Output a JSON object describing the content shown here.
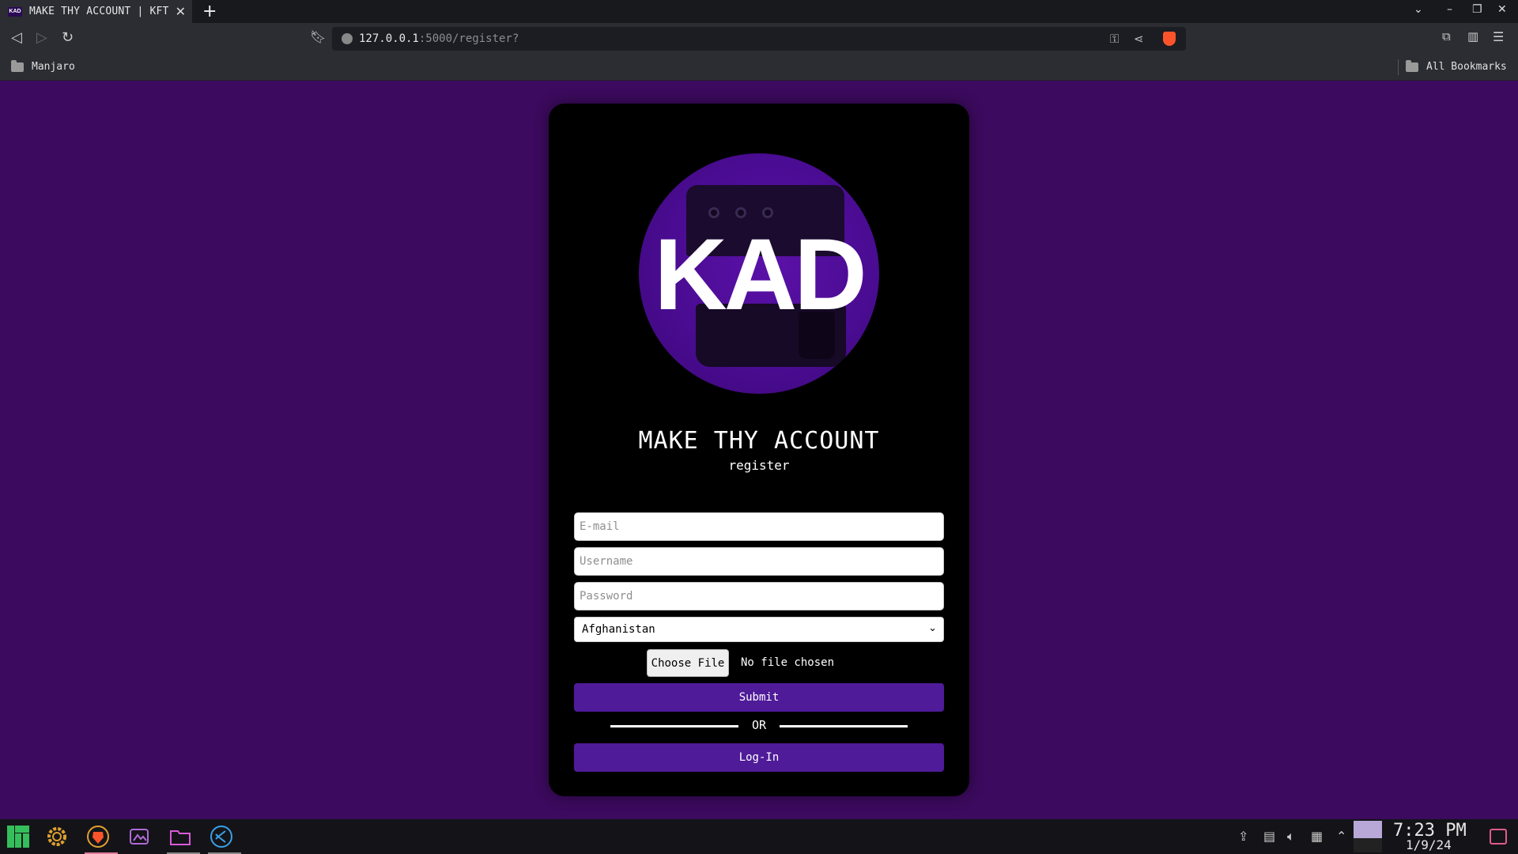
{
  "browser": {
    "tab": {
      "title": "MAKE THY ACCOUNT | KFT",
      "favicon_text": "KAD"
    },
    "url": {
      "host": "127.0.0.1",
      "rest": ":5000/register?"
    },
    "bookmarks": {
      "left": "Manjaro",
      "right": "All Bookmarks"
    }
  },
  "form": {
    "logo_text": "KAD",
    "title": "MAKE THY ACCOUNT",
    "subtitle": "register",
    "email_placeholder": "E-mail",
    "username_placeholder": "Username",
    "password_placeholder": "Password",
    "country_selected": "Afghanistan",
    "file_button": "Choose File",
    "file_status": "No file chosen",
    "submit_label": "Submit",
    "or_label": "OR",
    "login_label": "Log-In"
  },
  "taskbar": {
    "time": "7:23 PM",
    "date": "1/9/24"
  },
  "colors": {
    "page_bg": "#3c0a5e",
    "card_bg": "#000000",
    "accent": "#4f1b99",
    "logo_bg": "#4a0c92"
  }
}
